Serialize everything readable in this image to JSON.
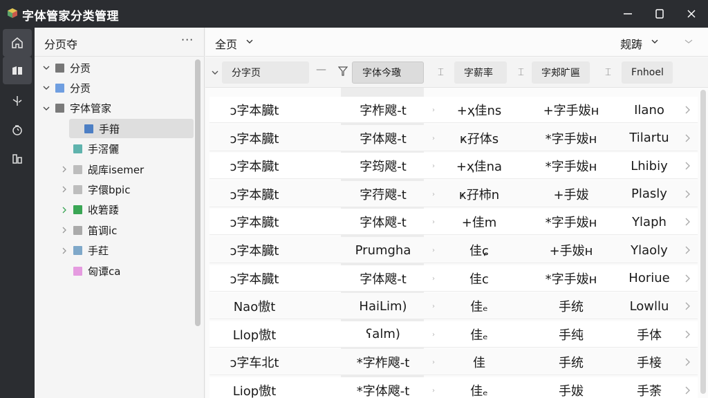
{
  "window": {
    "title": "字体管家分类管理"
  },
  "activity_bar": {
    "items": [
      {
        "name": "home-icon"
      },
      {
        "name": "library-icon"
      },
      {
        "name": "code-icon"
      },
      {
        "name": "sync-icon"
      },
      {
        "name": "panels-icon"
      }
    ]
  },
  "sidebar": {
    "title": "分页夺",
    "more": "···",
    "tree": [
      {
        "label": "分贡",
        "color": "#777777",
        "level": 0,
        "expanded": true
      },
      {
        "label": "分贡",
        "color": "#6f9ee0",
        "level": 0,
        "expanded": true
      },
      {
        "label": "字体管家",
        "color": "#7a7a7a",
        "level": 0,
        "expanded": true
      },
      {
        "label": "手箝",
        "color": "#4d7fc4",
        "level": 1,
        "selected": true
      },
      {
        "label": "手滘儷",
        "color": "#5fb3ad",
        "level": 1
      },
      {
        "label": "觇库isemer",
        "color": "#bdbdbd",
        "level": 1,
        "collapsed": true
      },
      {
        "label": "字儇bpic",
        "color": "#bdbdbd",
        "level": 1,
        "collapsed": true
      },
      {
        "label": "收箬踒",
        "color": "#3aa655",
        "level": 1,
        "collapsed": true,
        "green": true
      },
      {
        "label": "笛调ic",
        "color": "#aaaaaa",
        "level": 1,
        "collapsed": true
      },
      {
        "label": "手荭",
        "color": "#7fa8c9",
        "level": 1,
        "collapsed": true
      },
      {
        "label": "匈谭ca",
        "color": "#e59be0",
        "level": 1
      }
    ]
  },
  "main": {
    "title": "全页",
    "view_label": "觌踌",
    "filters": [
      {
        "label": "分字页"
      },
      {
        "label": "字体今璥",
        "active": true
      },
      {
        "label": "字薪率"
      },
      {
        "label": "字郏旷匾"
      },
      {
        "label": "Fnhoel"
      }
    ],
    "rows": [
      [
        "ɔ字本臓t",
        "字柞飕-t",
        "+ҳ佳ns",
        "+字手妭ʜ",
        "Ilano"
      ],
      [
        "ɔ字本臓t",
        "字体飕-t",
        "ҝ孖体s",
        "*字手妭ʜ",
        "Tilartu"
      ],
      [
        "ɔ字本臓t",
        "字筠飕-t",
        "+ҳ佳na",
        "*字手妭ʜ",
        "Lhibiy"
      ],
      [
        "ɔ字本臓t",
        "字荇飕-t",
        "ҝ孖柿n",
        "+手妭",
        "Plasly"
      ],
      [
        "ɔ字本臓t",
        "字体飕-t",
        "+佳m",
        "*字手妭ʜ",
        "Ylaph"
      ],
      [
        "ɔ字本臓t",
        "Prumgha",
        "佳ɕ",
        "+手妭ʜ",
        "Ylaoly"
      ],
      [
        "ɔ字本臓t",
        "字体飕-t",
        "佳c",
        "*字手妭ʜ",
        "Horiue"
      ],
      [
        "Nao慠t",
        "HaiLim)",
        "佳ₑ",
        "手统",
        "Lowllu"
      ],
      [
        "Llop慠t",
        "ʕalm)",
        "佳ₑ",
        "手纯",
        "手体"
      ],
      [
        "ɔ字车北t",
        "*字柞飕-t",
        "佳",
        "手统",
        "手椄"
      ],
      [
        "Liop慠t",
        "*字体飕-t",
        "佳ₑ",
        "手妭",
        "手荼"
      ]
    ]
  }
}
